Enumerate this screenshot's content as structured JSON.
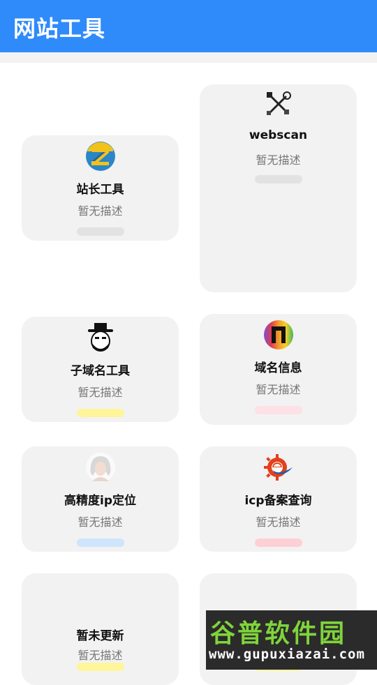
{
  "appbar": {
    "title": "网站工具"
  },
  "cards": [
    {
      "title": "站长工具",
      "desc": "暂无描述",
      "icon": "z-logo-icon",
      "pill_color": "#e2e2e2"
    },
    {
      "title": "webscan",
      "desc": "暂无描述",
      "icon": "tools-icon",
      "pill_color": "#e2e2e2"
    },
    {
      "title": "子域名工具",
      "desc": "暂无描述",
      "icon": "hat-man-icon",
      "pill_color": "#fff59a"
    },
    {
      "title": "域名信息",
      "desc": "暂无描述",
      "icon": "rainbow-n-icon",
      "pill_color": "#fde1e7"
    },
    {
      "title": "高精度ip定位",
      "desc": "暂无描述",
      "icon": "portrait-icon",
      "pill_color": "#cfe5fb"
    },
    {
      "title": "icp备案查询",
      "desc": "暂无描述",
      "icon": "e-gear-icon",
      "pill_color": "#fdd0d6"
    },
    {
      "title": "暂未更新",
      "desc": "暂无描述",
      "icon": "",
      "pill_color": "#fff59a"
    },
    {
      "title": "",
      "desc": "",
      "icon": "",
      "pill_color": ""
    }
  ],
  "watermark": {
    "big": "谷普软件园",
    "small": "www.gupuxiazai.com"
  }
}
